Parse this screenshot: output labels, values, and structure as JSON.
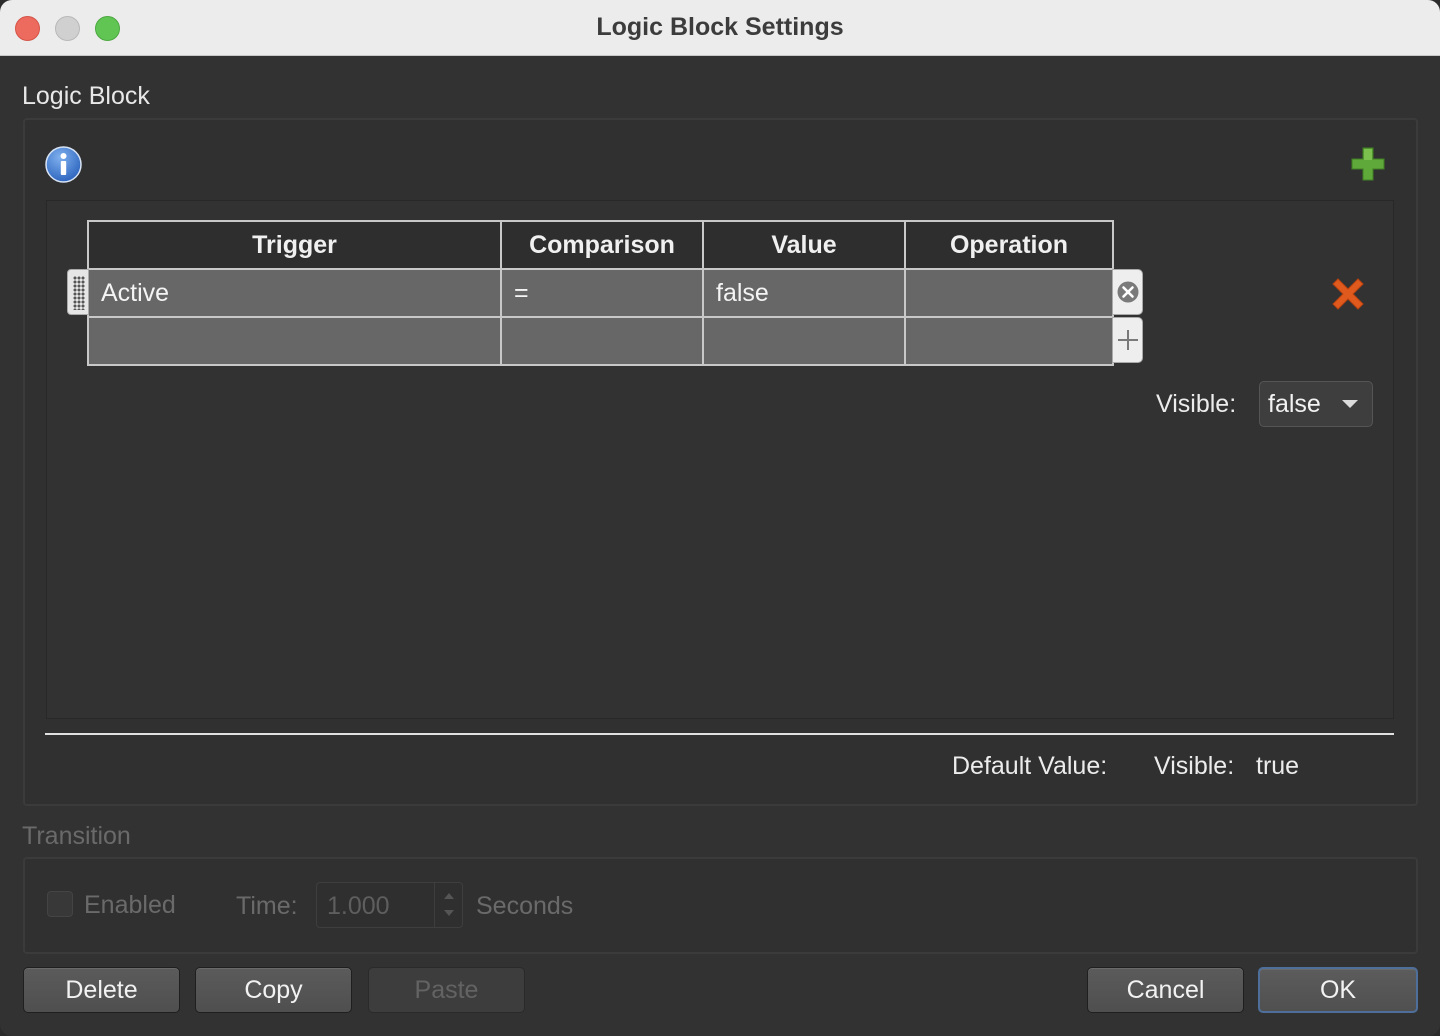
{
  "window": {
    "title": "Logic Block Settings"
  },
  "logic_block": {
    "group_label": "Logic Block",
    "table": {
      "columns": [
        "Trigger",
        "Comparison",
        "Value",
        "Operation"
      ],
      "rows": [
        [
          "Active",
          "=",
          "false",
          ""
        ],
        [
          "",
          "",
          "",
          ""
        ]
      ]
    },
    "visible_label": "Visible:",
    "visible_value": "false",
    "default_value_label": "Default Value:",
    "default_visible_label": "Visible:",
    "default_visible_value": "true",
    "icons": {
      "info": "info-icon",
      "add": "plus-icon",
      "delete": "x-icon"
    }
  },
  "transition": {
    "group_label": "Transition",
    "enabled_label": "Enabled",
    "enabled_checked": false,
    "time_label": "Time:",
    "time_value": "1.000",
    "seconds_label": "Seconds"
  },
  "buttons": {
    "delete": "Delete",
    "copy": "Copy",
    "paste": "Paste",
    "cancel": "Cancel",
    "ok": "OK"
  },
  "colors": {
    "add_green": "#5fa83a",
    "delete_orange": "#e05a1e",
    "info_blue": "#3a78c9"
  }
}
